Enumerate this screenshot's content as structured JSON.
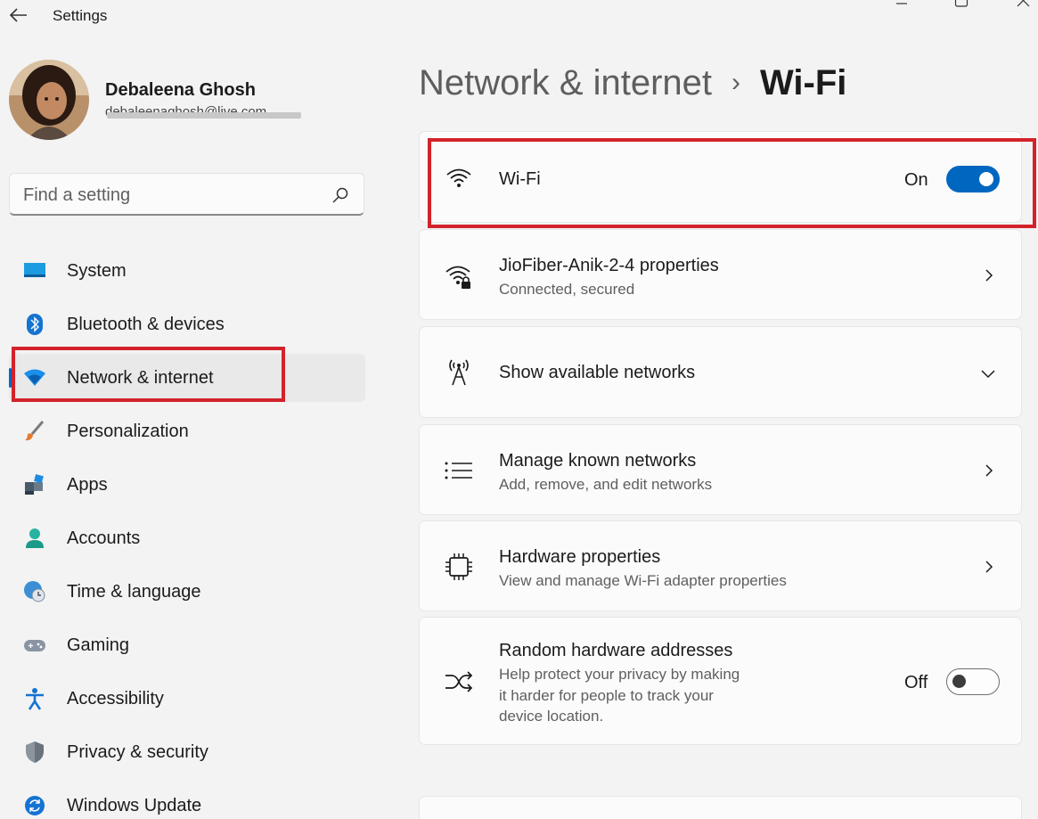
{
  "window": {
    "title": "Settings"
  },
  "profile": {
    "name": "Debaleena Ghosh",
    "email": "debaleenaghosh@live.com"
  },
  "search": {
    "placeholder": "Find a setting"
  },
  "sidebar": {
    "items": [
      {
        "label": "System",
        "icon": "system-icon"
      },
      {
        "label": "Bluetooth & devices",
        "icon": "bluetooth-icon"
      },
      {
        "label": "Network & internet",
        "icon": "wifi-icon",
        "active": true
      },
      {
        "label": "Personalization",
        "icon": "brush-icon"
      },
      {
        "label": "Apps",
        "icon": "apps-icon"
      },
      {
        "label": "Accounts",
        "icon": "person-icon"
      },
      {
        "label": "Time & language",
        "icon": "globe-clock-icon"
      },
      {
        "label": "Gaming",
        "icon": "gamepad-icon"
      },
      {
        "label": "Accessibility",
        "icon": "accessibility-icon"
      },
      {
        "label": "Privacy & security",
        "icon": "shield-icon"
      },
      {
        "label": "Windows Update",
        "icon": "update-icon"
      }
    ]
  },
  "breadcrumb": {
    "parent": "Network & internet",
    "separator": "›",
    "current": "Wi-Fi"
  },
  "cards": {
    "wifi": {
      "title": "Wi-Fi",
      "state": "On"
    },
    "properties": {
      "title": "JioFiber-Anik-2-4 properties",
      "subtitle": "Connected, secured"
    },
    "available": {
      "title": "Show available networks"
    },
    "known": {
      "title": "Manage known networks",
      "subtitle": "Add, remove, and edit networks"
    },
    "hardware": {
      "title": "Hardware properties",
      "subtitle": "View and manage Wi-Fi adapter properties"
    },
    "random": {
      "title": "Random hardware addresses",
      "subtitle_lines": [
        "Help protect your privacy by making",
        "it harder for people to track your",
        "device location."
      ],
      "state": "Off"
    }
  },
  "colors": {
    "accent": "#0067c0",
    "highlight_box": "#d3222a"
  }
}
